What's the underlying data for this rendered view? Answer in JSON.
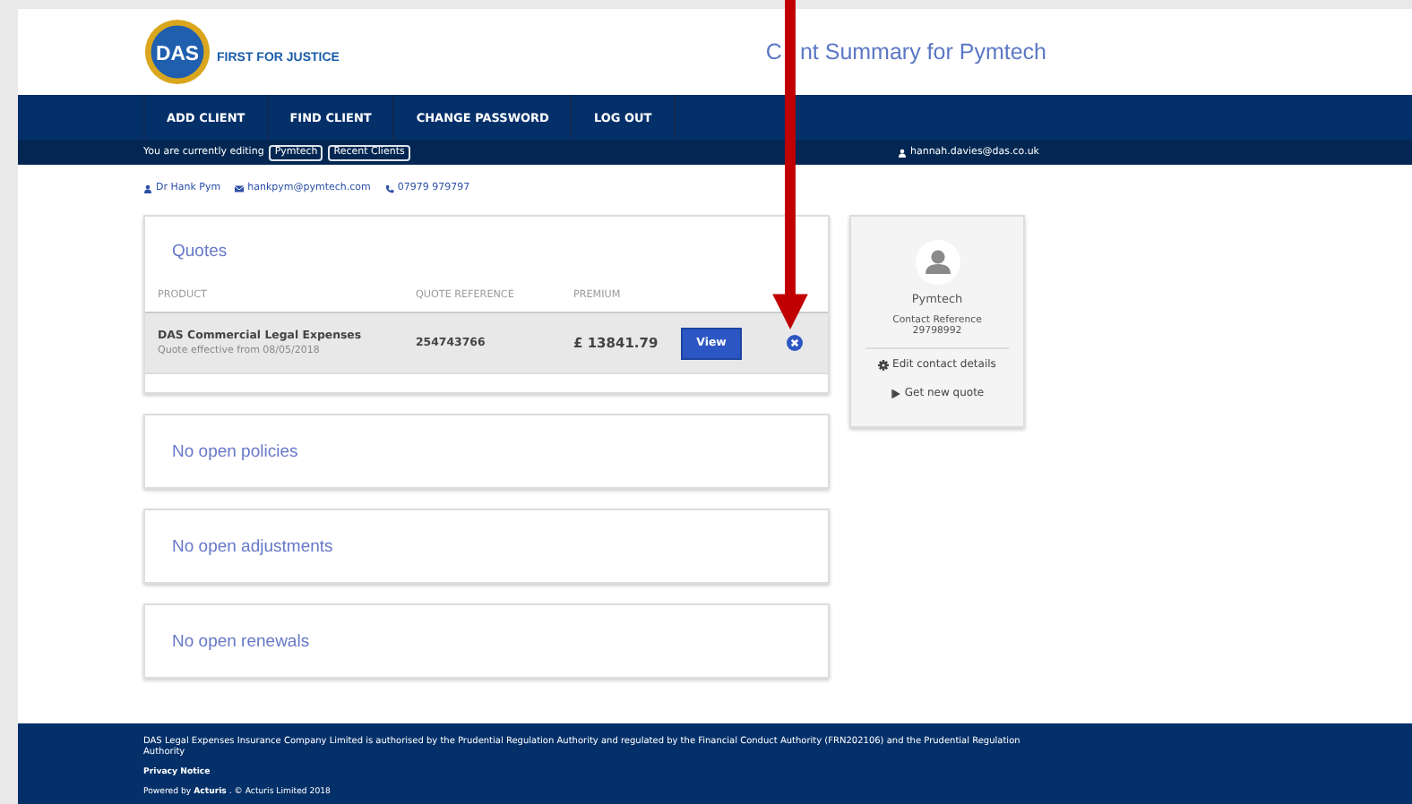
{
  "header": {
    "logo_text": "DAS",
    "tagline": "FIRST FOR JUSTICE",
    "title_parts": [
      "C",
      "nt Summary for Pymtech"
    ]
  },
  "nav": [
    "ADD CLIENT",
    "FIND CLIENT",
    "CHANGE PASSWORD",
    "LOG OUT"
  ],
  "subbar": {
    "label": "You are currently editing",
    "chips": [
      "Pymtech",
      "Recent Clients"
    ],
    "user": "hannah.davies@das.co.uk"
  },
  "contact": {
    "name": "Dr Hank Pym",
    "email": "hankpym@pymtech.com",
    "phone": "07979 979797"
  },
  "quotes": {
    "title": "Quotes",
    "columns": [
      "PRODUCT",
      "QUOTE REFERENCE",
      "PREMIUM"
    ],
    "rows": [
      {
        "product": "DAS Commercial Legal Expenses",
        "effective": "Quote effective from 08/05/2018",
        "reference": "254743766",
        "premium": "£ 13841.79",
        "button": "View"
      }
    ]
  },
  "sections": [
    "No open policies",
    "No open adjustments",
    "No open renewals"
  ],
  "client_card": {
    "name": "Pymtech",
    "ref_label": "Contact Reference",
    "ref": "29798992",
    "actions": [
      {
        "kind": "edit",
        "label": "Edit contact details"
      },
      {
        "kind": "quote",
        "label": "Get new quote"
      }
    ]
  },
  "footer": {
    "legal": "DAS Legal Expenses Insurance Company Limited is authorised by the Prudential Regulation Authority and regulated by the Financial Conduct Authority (FRN202106) and the Prudential Regulation Authority",
    "privacy": "Privacy Notice",
    "powered": "Powered by **Acturis** . © Acturis Limited 2018"
  }
}
